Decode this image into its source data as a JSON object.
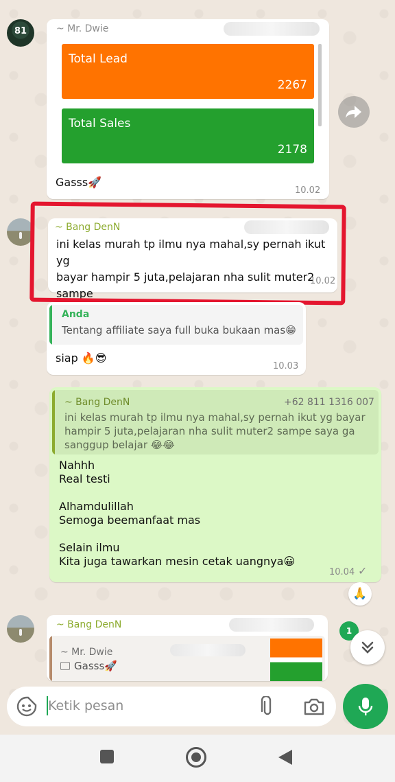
{
  "colors": {
    "incoming_bubble": "#ffffff",
    "outgoing_bubble": "#dcf8c6",
    "lead_card": "#ff7300",
    "sales_card": "#24a02e",
    "highlight": "#e4162f",
    "accent": "#1fa855"
  },
  "messages": {
    "m1": {
      "sender": "~ Mr. Dwie",
      "cards": [
        {
          "label": "Total Lead",
          "value": "2267"
        },
        {
          "label": "Total Sales",
          "value": "2178"
        }
      ],
      "text": "Gasss🚀",
      "time": "10.02"
    },
    "m2": {
      "sender": "~ Bang DenN",
      "text": "ini kelas murah tp ilmu nya mahal,sy pernah ikut yg\nbayar hampir 5 juta,pelajaran nha sulit muter2 sampe\nsaya ga sanggup belajar 😂😂",
      "time": "10.02"
    },
    "m3": {
      "quote_sender": "Anda",
      "quote_text": "Tentang affiliate saya full buka bukaan mas😁",
      "text": "siap 🔥😎",
      "time": "10.03"
    },
    "m4": {
      "quote_sender": "~ Bang DenN",
      "quote_phone": "+62 811 1316 007",
      "quote_text": "ini kelas murah tp ilmu nya mahal,sy pernah ikut yg bayar\nhampir 5 juta,pelajaran nha sulit muter2 sampe saya ga\nsanggup belajar 😂😂",
      "text": "Nahhh\nReal testi\n\nAlhamdulillah\nSemoga beemanfaat mas\n\nSelain ilmu\nKita juga tawarkan mesin cetak uangnya😀",
      "time": "10.04",
      "tick": "✓",
      "reaction": "🙏"
    },
    "m5": {
      "sender": "~ Bang DenN",
      "quote_sender": "~ Mr. Dwie",
      "quote_text": "Gasss🚀"
    }
  },
  "unread_count": "1",
  "composer": {
    "placeholder": "Ketik pesan"
  },
  "icons": {
    "forward": "forward-icon",
    "scroll_down": "chevron-double-down-icon",
    "emoji": "sticker-icon",
    "attach": "paperclip-icon",
    "camera": "camera-icon",
    "mic": "mic-icon"
  }
}
